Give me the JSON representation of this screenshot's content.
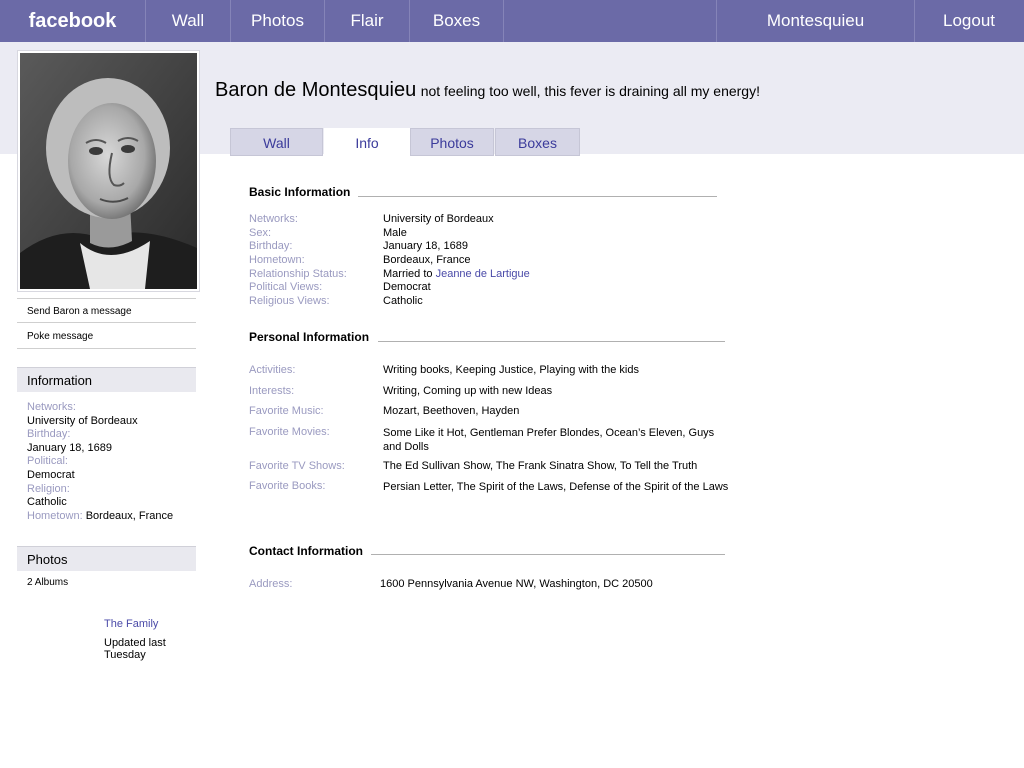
{
  "topnav": {
    "logo": "facebook",
    "items": [
      "Wall",
      "Photos",
      "Flair",
      "Boxes"
    ],
    "user": "Montesquieu",
    "logout": "Logout"
  },
  "profile": {
    "name": "Baron de Montesquieu",
    "status": "not feeling too well, this fever is draining all my energy!"
  },
  "tabs": [
    "Wall",
    "Info",
    "Photos",
    "Boxes"
  ],
  "sidebar": {
    "send_message": "Send Baron a message",
    "poke": "Poke message",
    "info_title": "Information",
    "info": [
      {
        "label": "Networks:",
        "value": "University of Bordeaux"
      },
      {
        "label": "Birthday:",
        "value": "January 18, 1689"
      },
      {
        "label": "Political:",
        "value": "Democrat"
      },
      {
        "label": "Religion:",
        "value": "Catholic"
      },
      {
        "label": "Hometown:",
        "value": "Bordeaux, France"
      }
    ],
    "photos_title": "Photos",
    "albums_count": "2 Albums",
    "album_name": "The Family",
    "album_updated": "Updated last Tuesday"
  },
  "basic": {
    "title": "Basic Information",
    "rows": [
      {
        "label": "Networks:",
        "value": "University of Bordeaux"
      },
      {
        "label": "Sex:",
        "value": "Male"
      },
      {
        "label": "Birthday:",
        "value": "January 18, 1689"
      },
      {
        "label": "Hometown:",
        "value": "Bordeaux, France"
      },
      {
        "label": "Relationship Status:",
        "value": "Married to ",
        "link": "Jeanne de Lartigue"
      },
      {
        "label": "Political Views:",
        "value": "Democrat"
      },
      {
        "label": "Religious Views:",
        "value": "Catholic"
      }
    ]
  },
  "personal": {
    "title": "Personal Information",
    "rows": [
      {
        "label": "Activities:",
        "value": "Writing books, Keeping Justice, Playing with the kids"
      },
      {
        "label": "Interests:",
        "value": "Writing, Coming up with new Ideas"
      },
      {
        "label": "Favorite Music:",
        "value": "Mozart, Beethoven, Hayden"
      },
      {
        "label": "Favorite Movies:",
        "value": "Some Like it Hot, Gentleman Prefer Blondes, Ocean’s Eleven, Guys and Dolls"
      },
      {
        "label": "Favorite TV Shows:",
        "value": "The Ed Sullivan Show, The Frank Sinatra Show, To Tell the Truth"
      },
      {
        "label": "Favorite Books:",
        "value": "Persian Letter, The Spirit of the Laws, Defense of the Spirit of the Laws"
      }
    ]
  },
  "contact": {
    "title": "Contact Information",
    "rows": [
      {
        "label": "Address:",
        "value": "1600 Pennsylvania Avenue NW, Washington, DC 20500"
      }
    ]
  },
  "colors": {
    "topbar": "#6b6aa7",
    "band": "#ebebf3",
    "label": "#9a9ac0",
    "link": "#4a4aa8"
  }
}
